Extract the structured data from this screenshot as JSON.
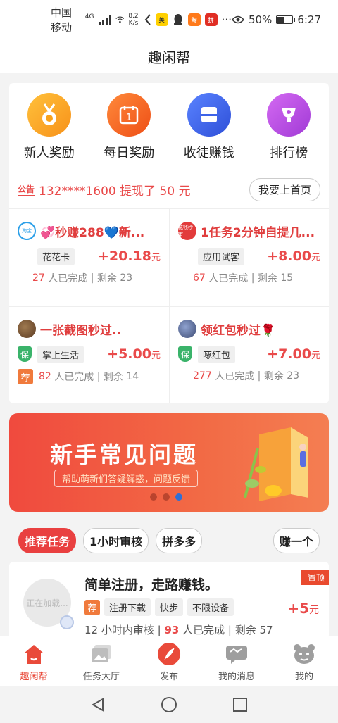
{
  "status_bar": {
    "carrier": "中国移动",
    "network": "4G",
    "speed_value": "8.2",
    "speed_unit": "K/s",
    "battery": "50%",
    "battery_level": 0.5,
    "time": "6:27",
    "app_icons": [
      "meituan-icon",
      "qq-icon",
      "taobao-icon",
      "pinduoduo-icon"
    ],
    "more": "···"
  },
  "header": {
    "title": "趣闲帮"
  },
  "quick_actions": [
    {
      "label": "新人奖励",
      "icon": "medal-icon",
      "color": "#f9a21b"
    },
    {
      "label": "每日奖励",
      "icon": "calendar-icon",
      "color": "#f26a1b"
    },
    {
      "label": "收徒赚钱",
      "icon": "box-icon",
      "color": "#3d63e8"
    },
    {
      "label": "排行榜",
      "icon": "trophy-icon",
      "color": "#b94be0"
    }
  ],
  "notice": {
    "icon_label": "公告",
    "text": "132****1600 提现了 50 元",
    "button": "我要上首页"
  },
  "tasks": [
    {
      "title": "💞秒赚288💙新...",
      "avatar_text": "淘宝",
      "avatar_color": "#2da0e8",
      "verified": false,
      "tag": "花花卡",
      "reward": "+20.18",
      "unit": "元",
      "recommended": false,
      "done": "27",
      "remaining": "23",
      "done_label": "人已完成",
      "remaining_label": "剩余"
    },
    {
      "title": "1任务2分钟自提几...",
      "avatar_text": "花钱秒审",
      "avatar_color": "#e23b3b",
      "verified": false,
      "tag": "应用试客",
      "reward": "+8.00",
      "unit": "元",
      "recommended": false,
      "done": "67",
      "remaining": "15",
      "done_label": "人已完成",
      "remaining_label": "剩余"
    },
    {
      "title": "一张截图秒过..",
      "avatar_text": "",
      "avatar_color": "#7a5a3a",
      "verified": true,
      "tag": "掌上生活",
      "reward": "+5.00",
      "unit": "元",
      "recommended": true,
      "done": "82",
      "remaining": "14",
      "done_label": "人已完成",
      "remaining_label": "剩余"
    },
    {
      "title": "领红包秒过🌹",
      "avatar_text": "",
      "avatar_color": "#5b6e9a",
      "verified": true,
      "tag": "啄红包",
      "reward": "+7.00",
      "unit": "元",
      "recommended": false,
      "done": "277",
      "remaining": "23",
      "done_label": "人已完成",
      "remaining_label": "剩余"
    }
  ],
  "badges": {
    "verified": "保",
    "recommended": "荐"
  },
  "banner": {
    "title": "新手常见问题",
    "subtitle": "帮助萌新们答疑解惑，问题反馈",
    "slide_count": 3,
    "active_slide": 3
  },
  "tabs": [
    {
      "label": "推荐任务",
      "active": true
    },
    {
      "label": "1小时审核",
      "active": false
    },
    {
      "label": "拼多多",
      "active": false
    },
    {
      "label": "赚一个",
      "active": false
    }
  ],
  "featured_task": {
    "pin_label": "置顶",
    "avatar_placeholder": "正在加载...",
    "title": "简单注册，走路赚钱。",
    "recommend_badge": "荐",
    "tags": [
      "注册下载",
      "快步",
      "不限设备"
    ],
    "reward": "+5",
    "unit": "元",
    "review_time": "12 小时内审核",
    "done": "93",
    "done_label": "人已完成",
    "remaining": "剩余 57"
  },
  "bottom_nav": [
    {
      "label": "趣闲帮",
      "icon": "home-icon",
      "active": true
    },
    {
      "label": "任务大厅",
      "icon": "image-icon",
      "active": false
    },
    {
      "label": "发布",
      "icon": "feather-icon",
      "active": false
    },
    {
      "label": "我的消息",
      "icon": "message-icon",
      "active": false
    },
    {
      "label": "我的",
      "icon": "profile-icon",
      "active": false
    }
  ],
  "system_nav": [
    "back-icon",
    "home-circle-icon",
    "recents-icon"
  ],
  "colors": {
    "accent": "#e94a4a",
    "active_nav": "#e94a3a",
    "banner": "#f04a3e"
  }
}
